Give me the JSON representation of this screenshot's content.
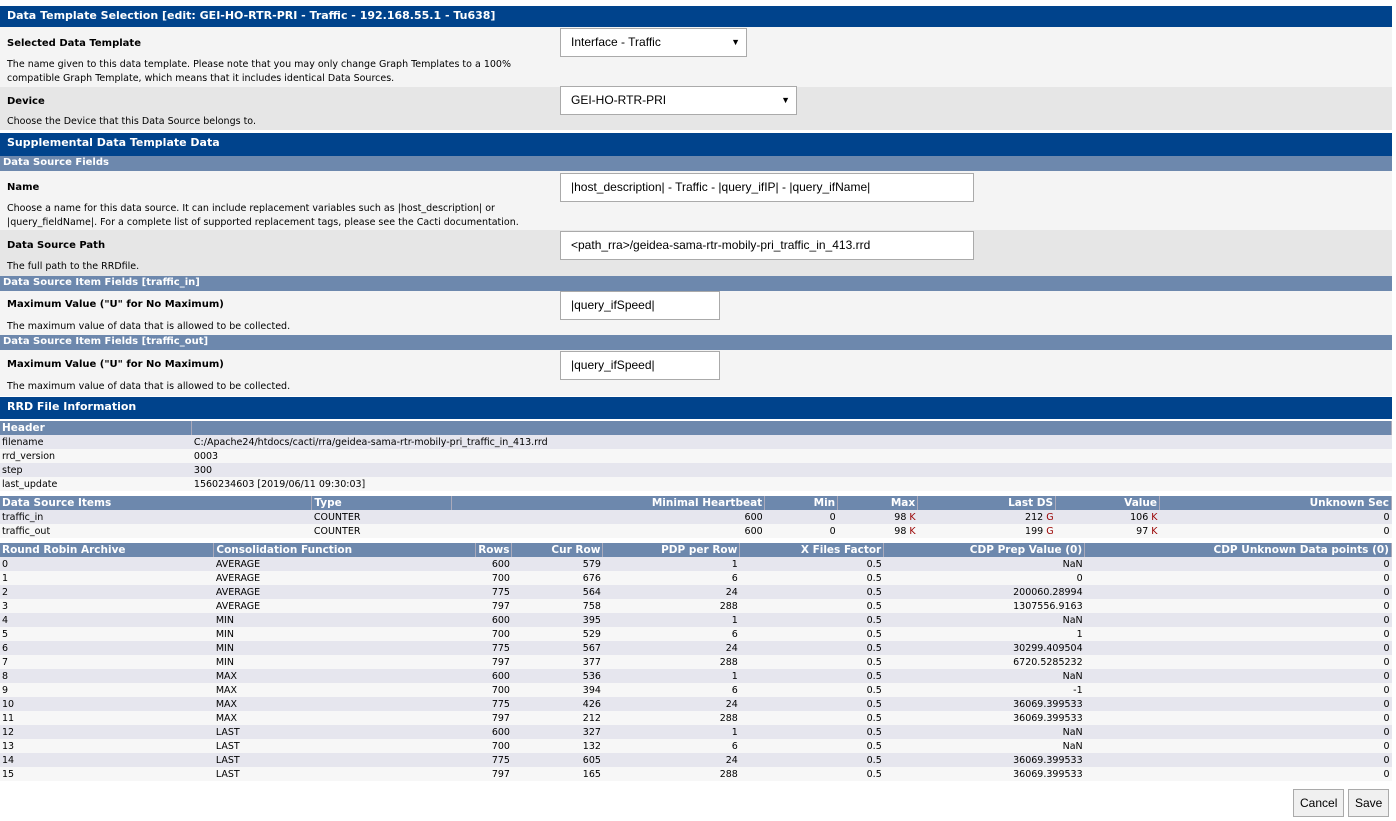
{
  "title": "Data Template Selection [edit: GEI-HO-RTR-PRI - Traffic - 192.168.55.1 - Tu638]",
  "template": {
    "label": "Selected Data Template",
    "desc": "The name given to this data template. Please note that you may only change Graph Templates to a 100% compatible Graph Template, which means that it includes identical Data Sources.",
    "value": "Interface - Traffic"
  },
  "device": {
    "label": "Device",
    "desc": "Choose the Device that this Data Source belongs to.",
    "value": "GEI-HO-RTR-PRI"
  },
  "supplemental": "Supplemental Data Template Data",
  "ds_fields": "Data Source Fields",
  "name": {
    "label": "Name",
    "desc": "Choose a name for this data source. It can include replacement variables such as |host_description| or |query_fieldName|. For a complete list of supported replacement tags, please see the Cacti documentation.",
    "value": "|host_description| - Traffic - |query_ifIP| - |query_ifName|"
  },
  "path": {
    "label": "Data Source Path",
    "desc": "The full path to the RRDfile.",
    "value": "<path_rra>/geidea-sama-rtr-mobily-pri_traffic_in_413.rrd"
  },
  "item_in": {
    "header": "Data Source Item Fields [traffic_in]",
    "label": "Maximum Value (\"U\" for No Maximum)",
    "desc": "The maximum value of data that is allowed to be collected.",
    "value": "|query_ifSpeed|"
  },
  "item_out": {
    "header": "Data Source Item Fields [traffic_out]",
    "label": "Maximum Value (\"U\" for No Maximum)",
    "desc": "The maximum value of data that is allowed to be collected.",
    "value": "|query_ifSpeed|"
  },
  "rrd_info": "RRD File Information",
  "header_table": {
    "columns": [
      "Header",
      ""
    ],
    "rows": [
      [
        "filename",
        "C:/Apache24/htdocs/cacti/rra/geidea-sama-rtr-mobily-pri_traffic_in_413.rrd"
      ],
      [
        "rrd_version",
        "0003"
      ],
      [
        "step",
        "300"
      ],
      [
        "last_update",
        "1560234603 [2019/06/11 09:30:03]"
      ]
    ]
  },
  "ds_table": {
    "columns": [
      "Data Source Items",
      "Type",
      "Minimal Heartbeat",
      "Min",
      "Max",
      "Last DS",
      "Value",
      "Unknown Sec"
    ],
    "rows": [
      [
        "traffic_in",
        "COUNTER",
        "600",
        "0",
        "98 K",
        "212 G",
        "106 K",
        "0"
      ],
      [
        "traffic_out",
        "COUNTER",
        "600",
        "0",
        "98 K",
        "199 G",
        "97 K",
        "0"
      ]
    ]
  },
  "rra_table": {
    "columns": [
      "Round Robin Archive",
      "Consolidation Function",
      "Rows",
      "Cur Row",
      "PDP per Row",
      "X Files Factor",
      "CDP Prep Value (0)",
      "CDP Unknown Data points (0)"
    ],
    "rows": [
      [
        "0",
        "AVERAGE",
        "600",
        "579",
        "1",
        "0.5",
        "NaN",
        "0"
      ],
      [
        "1",
        "AVERAGE",
        "700",
        "676",
        "6",
        "0.5",
        "0",
        "0"
      ],
      [
        "2",
        "AVERAGE",
        "775",
        "564",
        "24",
        "0.5",
        "200060.28994",
        "0"
      ],
      [
        "3",
        "AVERAGE",
        "797",
        "758",
        "288",
        "0.5",
        "1307556.9163",
        "0"
      ],
      [
        "4",
        "MIN",
        "600",
        "395",
        "1",
        "0.5",
        "NaN",
        "0"
      ],
      [
        "5",
        "MIN",
        "700",
        "529",
        "6",
        "0.5",
        "1",
        "0"
      ],
      [
        "6",
        "MIN",
        "775",
        "567",
        "24",
        "0.5",
        "30299.409504",
        "0"
      ],
      [
        "7",
        "MIN",
        "797",
        "377",
        "288",
        "0.5",
        "6720.5285232",
        "0"
      ],
      [
        "8",
        "MAX",
        "600",
        "536",
        "1",
        "0.5",
        "NaN",
        "0"
      ],
      [
        "9",
        "MAX",
        "700",
        "394",
        "6",
        "0.5",
        "-1",
        "0"
      ],
      [
        "10",
        "MAX",
        "775",
        "426",
        "24",
        "0.5",
        "36069.399533",
        "0"
      ],
      [
        "11",
        "MAX",
        "797",
        "212",
        "288",
        "0.5",
        "36069.399533",
        "0"
      ],
      [
        "12",
        "LAST",
        "600",
        "327",
        "1",
        "0.5",
        "NaN",
        "0"
      ],
      [
        "13",
        "LAST",
        "700",
        "132",
        "6",
        "0.5",
        "NaN",
        "0"
      ],
      [
        "14",
        "LAST",
        "775",
        "605",
        "24",
        "0.5",
        "36069.399533",
        "0"
      ],
      [
        "15",
        "LAST",
        "797",
        "165",
        "288",
        "0.5",
        "36069.399533",
        "0"
      ]
    ]
  },
  "buttons": {
    "cancel": "Cancel",
    "save": "Save"
  }
}
